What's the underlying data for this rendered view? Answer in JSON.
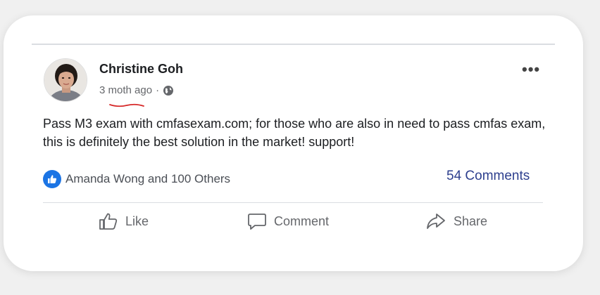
{
  "post": {
    "author": "Christine Goh",
    "time": "3 moth ago",
    "separator": "·",
    "visibility_icon": "globe-icon",
    "more_label": "•••",
    "text": "Pass M3 exam with cmfasexam.com; for those who are also in need to pass cmfas exam, this is definitely the best solution in the market! support!"
  },
  "reactions": {
    "icon": "like-badge-icon",
    "summary": "Amanda Wong and 100 Others",
    "comments": "54 Comments"
  },
  "actions": {
    "like": "Like",
    "comment": "Comment",
    "share": "Share"
  },
  "colors": {
    "link_blue": "#2d3f8e",
    "like_blue": "#1b74e4",
    "annotation_red": "#d62828"
  }
}
